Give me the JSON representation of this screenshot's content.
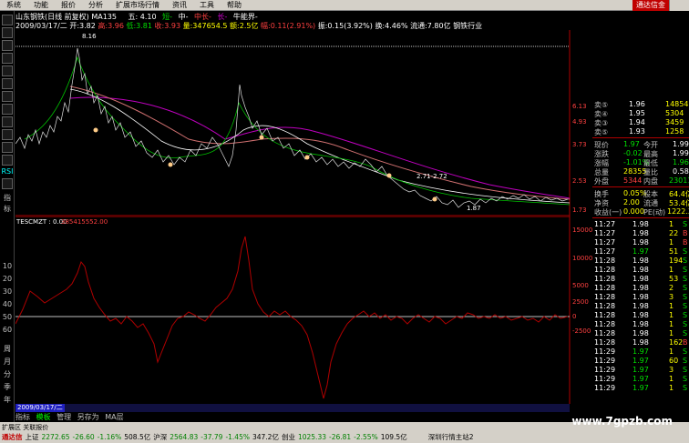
{
  "menu": {
    "items": [
      "系统",
      "功能",
      "报价",
      "分析",
      "扩展市场行情",
      "资讯",
      "工具",
      "帮助"
    ],
    "brand": "通达信金"
  },
  "title": {
    "stock": "山东钢铁(日线 前复权)",
    "ma_label": "MA135",
    "ma_value": "五: 4.10",
    "legend": [
      "短-",
      "中-",
      "中长-",
      "长-",
      "牛能界-"
    ]
  },
  "quote_line": {
    "date": "2009/03/17/二",
    "open": "开:3.82",
    "high": "高:3.96",
    "low": "低:3.81",
    "close": "收:3.93",
    "volume": "量:347654.5",
    "amount": "额:2.5亿",
    "change": "幅:0.11(2.91%)",
    "amplitude": "振:0.15(3.92%)",
    "turnover": "换:4.46%",
    "float": "流通:7.80亿",
    "industry": "钢铁行业"
  },
  "price_chart": {
    "peak_label": "8.16",
    "low_label": "1.87",
    "mid_label": "2.71-2.72",
    "right_axis": [
      "6.13",
      "4.93",
      "3.73",
      "2.53",
      "1.73"
    ]
  },
  "indicator": {
    "name": "TESCMZT : 0.00",
    "value": "385415552.00",
    "right_axis": [
      "15000",
      "10000",
      "5000",
      "2500",
      "0",
      "-2500"
    ],
    "toolbar": [
      "指标",
      "模板",
      "管理",
      "另存为",
      "MA层"
    ]
  },
  "bottom_date": "2009/03/17/二",
  "tabs_label": "扩展区 关联报价",
  "right_panel": {
    "asks": [
      {
        "label": "卖⑤",
        "price": "1.96",
        "vol": "14854"
      },
      {
        "label": "卖④",
        "price": "1.95",
        "vol": "5304"
      },
      {
        "label": "卖③",
        "price": "1.94",
        "vol": "3459"
      },
      {
        "label": "卖⑤",
        "price": "1.93",
        "vol": "1258"
      }
    ],
    "stats": [
      {
        "l1": "现价",
        "v1": "1.97",
        "l2": "今开",
        "v2": "1.99"
      },
      {
        "l1": "涨跌",
        "v1": "-0.02",
        "l2": "最高",
        "v2": "1.99"
      },
      {
        "l1": "涨幅",
        "v1": "-1.01%",
        "l2": "最低",
        "v2": "1.96"
      },
      {
        "l1": "总量",
        "v1": "28355",
        "l2": "量比",
        "v2": "0.58"
      },
      {
        "l1": "外盘",
        "v1": "5344",
        "l2": "内盘",
        "v2": "23011"
      },
      {
        "l1": "换手",
        "v1": "0.05%",
        "l2": "股本",
        "v2": "64.4亿"
      },
      {
        "l1": "净资",
        "v1": "2.00",
        "l2": "流通",
        "v2": "53.4亿"
      },
      {
        "l1": "收益(一)",
        "v1": "0.000",
        "l2": "PE(动)",
        "v2": "1222.3"
      }
    ],
    "ticks": [
      {
        "t": "11:27",
        "p": "1.98",
        "v": "1",
        "s": "S"
      },
      {
        "t": "11:27",
        "p": "1.98",
        "v": "22",
        "s": "B"
      },
      {
        "t": "11:27",
        "p": "1.98",
        "v": "1",
        "s": "B"
      },
      {
        "t": "11:27",
        "p": "1.97",
        "v": "51",
        "s": "S"
      },
      {
        "t": "11:28",
        "p": "1.98",
        "v": "194",
        "s": "S"
      },
      {
        "t": "11:28",
        "p": "1.98",
        "v": "1",
        "s": "S"
      },
      {
        "t": "11:28",
        "p": "1.98",
        "v": "53",
        "s": "S"
      },
      {
        "t": "11:28",
        "p": "1.98",
        "v": "2",
        "s": "S"
      },
      {
        "t": "11:28",
        "p": "1.98",
        "v": "3",
        "s": "S"
      },
      {
        "t": "11:28",
        "p": "1.98",
        "v": "1",
        "s": "S"
      },
      {
        "t": "11:28",
        "p": "1.98",
        "v": "1",
        "s": "S"
      },
      {
        "t": "11:28",
        "p": "1.98",
        "v": "1",
        "s": "S"
      },
      {
        "t": "11:28",
        "p": "1.98",
        "v": "1",
        "s": "S"
      },
      {
        "t": "11:28",
        "p": "1.98",
        "v": "162",
        "s": "B"
      },
      {
        "t": "11:29",
        "p": "1.97",
        "v": "1",
        "s": "S"
      },
      {
        "t": "11:29",
        "p": "1.97",
        "v": "60",
        "s": "S"
      },
      {
        "t": "11:29",
        "p": "1.97",
        "v": "3",
        "s": "S"
      },
      {
        "t": "11:29",
        "p": "1.97",
        "v": "1",
        "s": "S"
      },
      {
        "t": "11:29",
        "p": "1.97",
        "v": "1",
        "s": "S"
      }
    ]
  },
  "status": {
    "sh_label": "上证",
    "sh_index": "2272.65",
    "sh_chg": "-26.60",
    "sh_pct": "-1.16%",
    "sh_amt": "508.5亿",
    "sz_label": "沪深",
    "sz_index": "2564.83",
    "sz_chg": "-37.79",
    "sz_pct": "-1.45%",
    "sz_amt": "347.2亿",
    "cy_label": "创业",
    "cy_index": "1025.33",
    "cy_chg": "-26.81",
    "cy_pct": "-2.55%",
    "cy_amt": "109.5亿",
    "server": "深圳行情主站2",
    "brand": "通达信"
  },
  "left_toolbar": [
    "RSI",
    "指",
    "标",
    "10",
    "20",
    "30",
    "40",
    "50",
    "60",
    "周",
    "月",
    "分",
    "季",
    "年"
  ],
  "watermark": "www.7gpzb.com"
}
